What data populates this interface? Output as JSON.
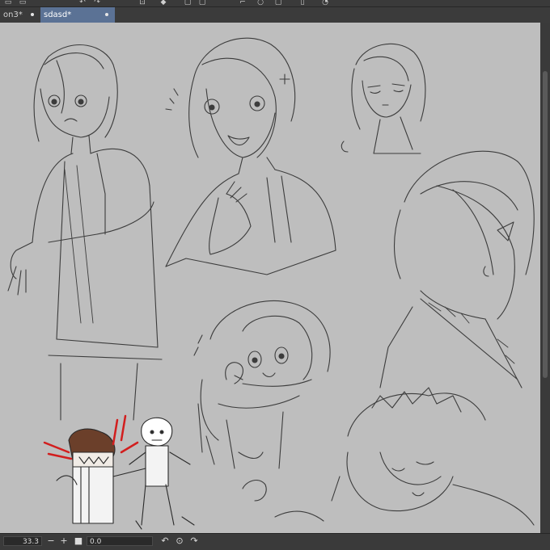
{
  "tabs": [
    {
      "label": "on3*",
      "active": false
    },
    {
      "label": "sdasd*",
      "active": true
    }
  ],
  "status": {
    "zoom": "33.3",
    "zoom_out": "−",
    "zoom_in": "+",
    "position": "0.0",
    "rotate_left": "↶",
    "rotate_reset": "⊙",
    "rotate_right": "↷"
  },
  "colors": {
    "canvas": "#bebebe",
    "active_tab": "#5b7295",
    "ink": "#3c3c3c",
    "red_accent": "#d21e1e"
  }
}
